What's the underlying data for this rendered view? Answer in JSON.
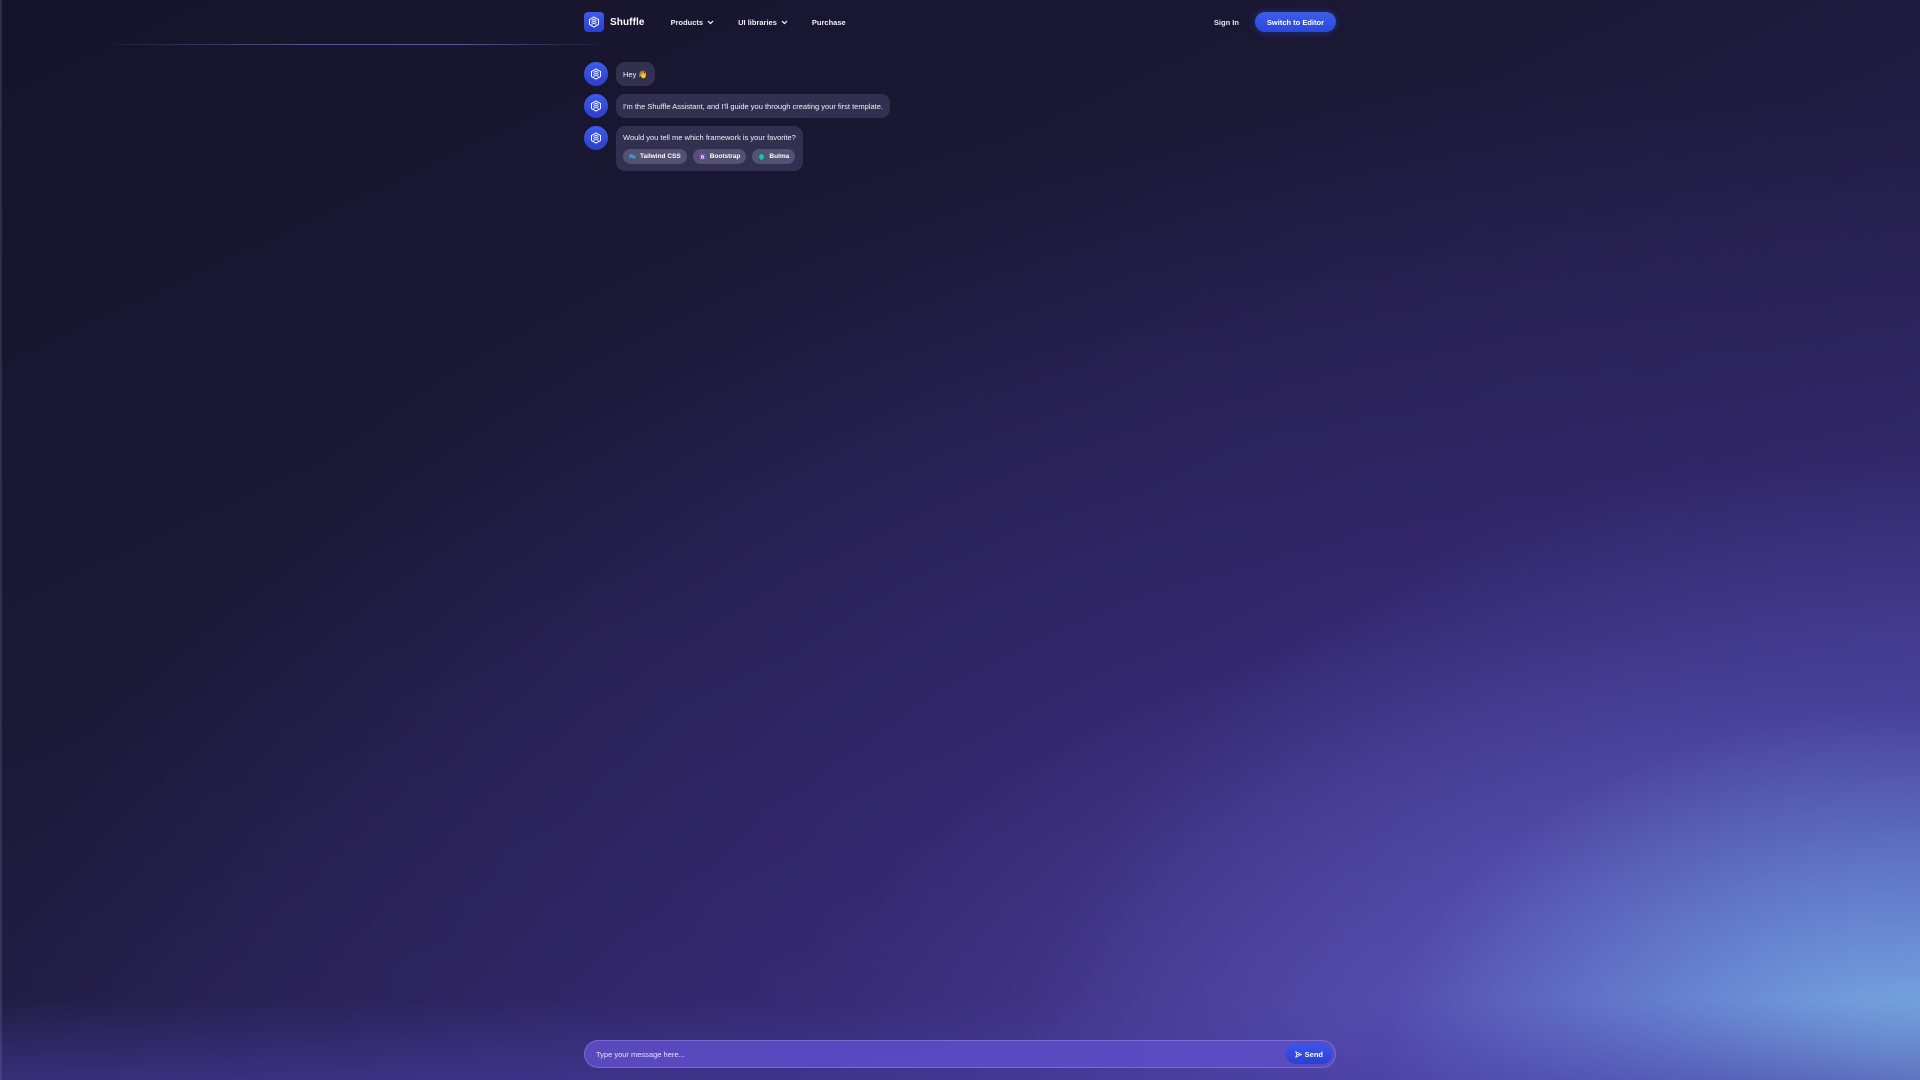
{
  "header": {
    "brand": "Shuffle",
    "nav": [
      {
        "label": "Products",
        "has_dropdown": true
      },
      {
        "label": "UI libraries",
        "has_dropdown": true
      },
      {
        "label": "Purchase",
        "has_dropdown": false
      }
    ],
    "sign_in": "Sign In",
    "switch_button": "Switch to Editor"
  },
  "chat": {
    "messages": [
      {
        "text": "Hey 👋"
      },
      {
        "text": "I'm the Shuffle Assistant, and I'll guide you through creating your first template."
      },
      {
        "text": "Would you tell me which framework is your favorite?"
      }
    ],
    "options": [
      {
        "label": "Tailwind CSS",
        "icon": "tailwind-icon",
        "color": "#38bdf8"
      },
      {
        "label": "Bootstrap",
        "icon": "bootstrap-icon",
        "color": "#7952b3"
      },
      {
        "label": "Bulma",
        "icon": "bulma-icon",
        "color": "#00d1b2"
      }
    ]
  },
  "input": {
    "placeholder": "Type your message here...",
    "send_label": "Send"
  },
  "colors": {
    "accent": "#2f4ce0",
    "bubble": "#343252",
    "input_bg": "#5f4ec8"
  }
}
